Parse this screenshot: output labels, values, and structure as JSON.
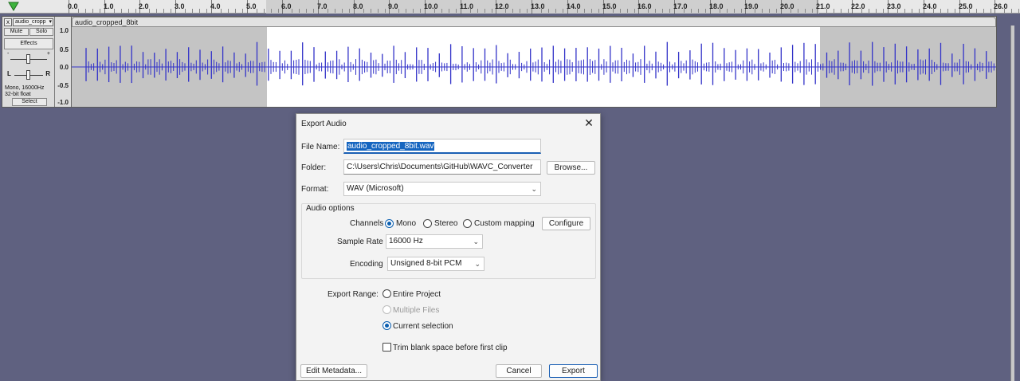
{
  "ruler": {
    "labels": [
      "0.0",
      "1.0",
      "2.0",
      "3.0",
      "4.0",
      "5.0",
      "6.0",
      "7.0",
      "8.0",
      "9.0",
      "10.0",
      "11.0",
      "12.0",
      "13.0",
      "14.0",
      "15.0",
      "16.0",
      "17.0",
      "18.0",
      "19.0",
      "20.0",
      "21.0",
      "22.0",
      "23.0",
      "24.0",
      "25.0",
      "26.0"
    ]
  },
  "track": {
    "close_glyph": "x",
    "name": "audio_cropp",
    "mute": "Mute",
    "solo": "Solo",
    "effects": "Effects",
    "gain_minus": "-",
    "gain_plus": "+",
    "pan_left": "L",
    "pan_right": "R",
    "info_line1": "Mono, 16000Hz",
    "info_line2": "32-bit float",
    "select": "Select",
    "vruler": [
      "1.0",
      "0.5",
      "0.0",
      "-0.5",
      "-1.0"
    ],
    "clip_name": "audio_cropped_8bit",
    "waveform_color": "#3232c8"
  },
  "dialog": {
    "title": "Export Audio",
    "close_glyph": "✕",
    "file_name_label": "File Name:",
    "file_name_value": "audio_cropped_8bit.wav",
    "folder_label": "Folder:",
    "folder_value": "C:\\Users\\Chris\\Documents\\GitHub\\WAVC_Converter",
    "browse": "Browse...",
    "format_label": "Format:",
    "format_value": "WAV (Microsoft)",
    "audio_options_title": "Audio options",
    "channels_label": "Channels",
    "channel_mono": "Mono",
    "channel_stereo": "Stereo",
    "channel_custom": "Custom mapping",
    "configure": "Configure",
    "sample_rate_label": "Sample Rate",
    "sample_rate_value": "16000 Hz",
    "encoding_label": "Encoding",
    "encoding_value": "Unsigned 8-bit PCM",
    "export_range_label": "Export Range:",
    "range_entire": "Entire Project",
    "range_multiple": "Multiple Files",
    "range_current": "Current selection",
    "trim_label": "Trim blank space before first clip",
    "edit_metadata": "Edit Metadata...",
    "cancel": "Cancel",
    "export": "Export"
  }
}
